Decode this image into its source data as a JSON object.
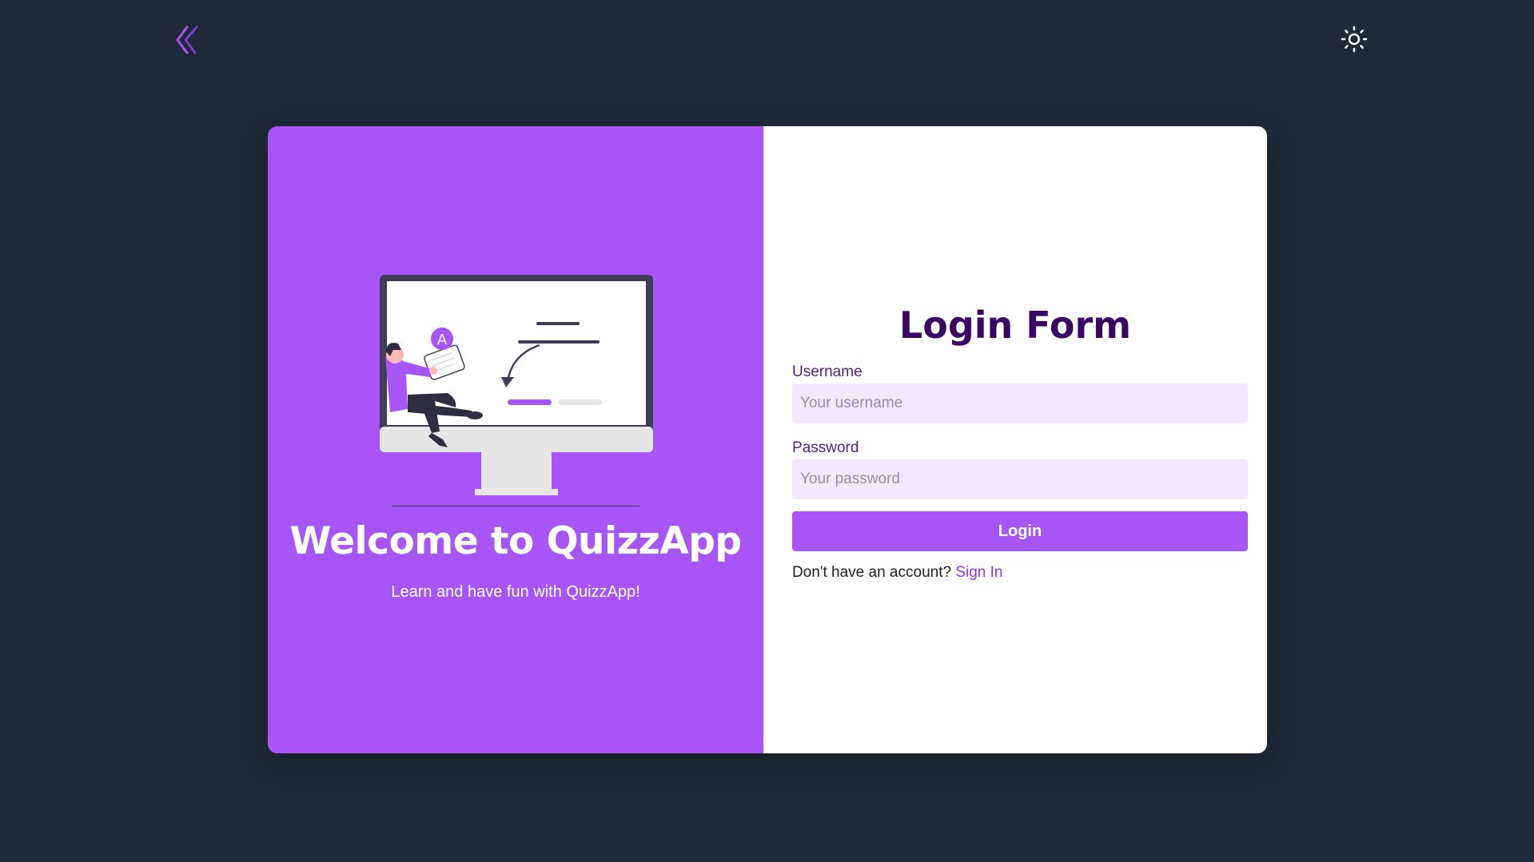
{
  "header": {
    "logo_icon": "double-chevron-left-icon",
    "theme_toggle_icon": "sun-icon"
  },
  "welcome": {
    "illustration_icon": "person-at-monitor-illustration",
    "illustration_letter": "A",
    "title": "Welcome to QuizzApp",
    "subtitle": "Learn and have fun with QuizzApp!"
  },
  "login_form": {
    "title": "Login Form",
    "username_label": "Username",
    "username_placeholder": "Your username",
    "username_value": "",
    "password_label": "Password",
    "password_placeholder": "Your password",
    "password_value": "",
    "submit_label": "Login",
    "signup_prompt": "Don't have an account?",
    "signup_link": "Sign In"
  },
  "colors": {
    "background": "#1f2937",
    "accent": "#a855f7",
    "input_bg": "#f3e8ff",
    "title": "#3b0764",
    "label": "#581c87",
    "link": "#9333ea"
  }
}
